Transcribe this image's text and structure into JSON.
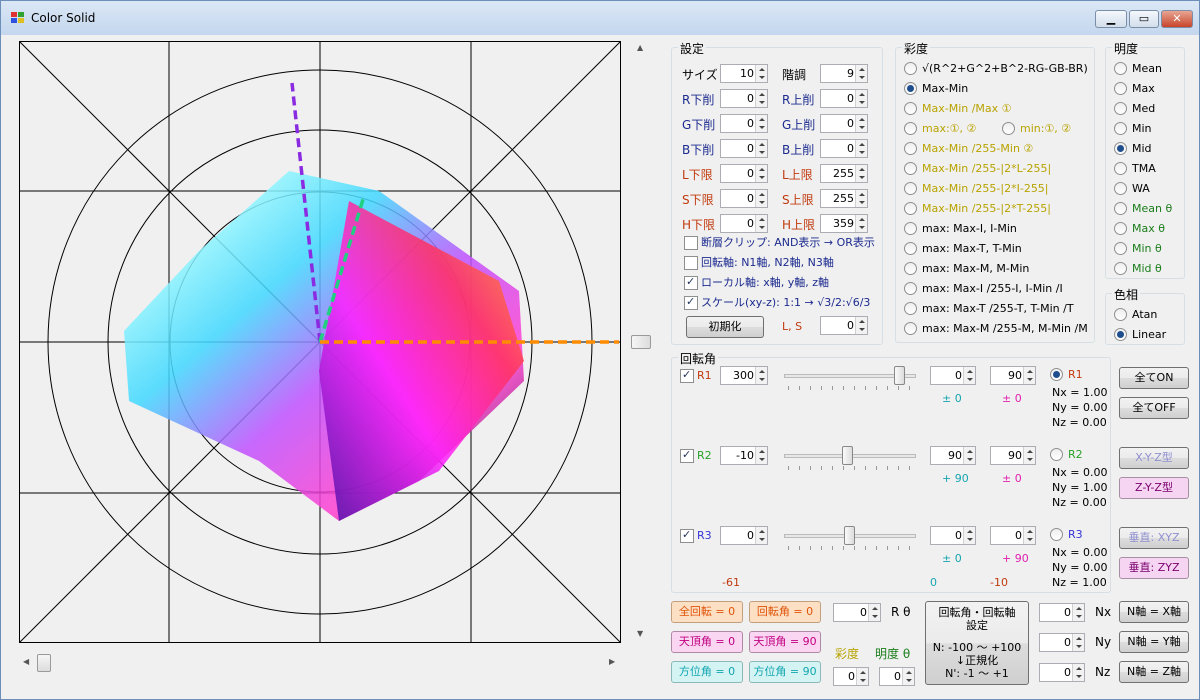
{
  "window": {
    "title": "Color Solid",
    "minimize": "▁",
    "maximize": "▭",
    "close": "✕"
  },
  "settings": {
    "title": "設定",
    "fields": [
      {
        "label": "サイズ",
        "value": "10"
      },
      {
        "label": "階調",
        "value": "9"
      },
      {
        "label": "R下削",
        "value": "0"
      },
      {
        "label": "R上削",
        "value": "0"
      },
      {
        "label": "G下削",
        "value": "0"
      },
      {
        "label": "G上削",
        "value": "0"
      },
      {
        "label": "B下削",
        "value": "0"
      },
      {
        "label": "B上削",
        "value": "0"
      },
      {
        "label": "L下限",
        "value": "0"
      },
      {
        "label": "L上限",
        "value": "255"
      },
      {
        "label": "S下限",
        "value": "0"
      },
      {
        "label": "S上限",
        "value": "255"
      },
      {
        "label": "H下限",
        "value": "0"
      },
      {
        "label": "H上限",
        "value": "359"
      }
    ],
    "checks": [
      {
        "label": "断層クリップ: AND表示 → OR表示",
        "checked": false
      },
      {
        "label": "回転軸: N1軸, N2軸, N3軸",
        "checked": false
      },
      {
        "label": "ローカル軸: x軸, y軸, z軸",
        "checked": true
      },
      {
        "label": "スケール(xy-z): 1:1 → √3/2:√6/3",
        "checked": true
      }
    ],
    "reset_button": "初期化",
    "ls_label": "L, S",
    "ls_value": "0"
  },
  "saturation": {
    "title": "彩度",
    "options": [
      "√(R^2+G^2+B^2-RG-GB-BR)",
      "Max-Min",
      "Max-Min /Max ①",
      "max:①, ②",
      "min:①, ②",
      "Max-Min /255-Min ②",
      "Max-Min /255-|2*L-255|",
      "Max-Min /255-|2*I-255|",
      "Max-Min /255-|2*T-255|",
      "max: Max-I, I-Min",
      "max: Max-T, T-Min",
      "max: Max-M, M-Min",
      "max: Max-I /255-I, I-Min /I",
      "max: Max-T /255-T, T-Min /T",
      "max: Max-M /255-M, M-Min /M"
    ],
    "selected": 1
  },
  "lightness": {
    "title": "明度",
    "options": [
      "Mean",
      "Max",
      "Med",
      "Min",
      "Mid",
      "TMA",
      "WA",
      "Mean θ",
      "Max θ",
      "Min θ",
      "Mid θ"
    ],
    "selected": 4
  },
  "hue": {
    "title": "色相",
    "options": [
      "Atan",
      "Linear"
    ],
    "selected": 1
  },
  "rotation": {
    "title": "回転角",
    "rows": [
      {
        "name": "R1",
        "checked": true,
        "value": "300",
        "slider_fraction": 0.92,
        "a": "0",
        "b": "90",
        "sub_a": "± 0",
        "sub_b": "± 0",
        "nx": "Nx = 1.00",
        "ny": "Ny = 0.00",
        "nz": "Nz = 0.00",
        "selected": true
      },
      {
        "name": "R2",
        "checked": true,
        "value": "-10",
        "slider_fraction": 0.48,
        "a": "90",
        "b": "90",
        "sub_a": "+ 90",
        "sub_b": "± 0",
        "nx": "Nx = 0.00",
        "ny": "Ny = 1.00",
        "nz": "Nz = 0.00",
        "selected": false
      },
      {
        "name": "R3",
        "checked": true,
        "value": "0",
        "slider_fraction": 0.5,
        "a": "0",
        "b": "0",
        "sub_a": "± 0",
        "sub_b": "+ 90",
        "nx": "Nx = 0.00",
        "ny": "Ny = 0.00",
        "nz": "Nz = 1.00",
        "selected": false
      }
    ],
    "footer": [
      "-61",
      "0",
      "-10"
    ],
    "buttons": [
      "全てON",
      "全てOFF",
      "X-Y-Z型",
      "Z-Y-Z型",
      "垂直: XYZ",
      "垂直: ZYZ"
    ]
  },
  "bottom": {
    "left_buttons": [
      "全回転 = 0",
      "回転角 = 0",
      "天頂角 = 0",
      "天頂角 = 90",
      "方位角 = 0",
      "方位角 = 90"
    ],
    "r_theta_value": "0",
    "r_theta_label": "R θ",
    "sat_label": "彩度",
    "light_label": "明度 θ",
    "sat_value": "0",
    "light_value": "0",
    "axis_box": {
      "title1": "回転角・回転軸",
      "title2": "設定",
      "line1": "N: -100 〜 +100",
      "line2": "↓正規化",
      "line3": "N': -1 〜 +1"
    },
    "n_rows": [
      {
        "value": "0",
        "label": "Nx",
        "button": "N軸 = X軸"
      },
      {
        "value": "0",
        "label": "Ny",
        "button": "N軸 = Y軸"
      },
      {
        "value": "0",
        "label": "Nz",
        "button": "N軸 = Z軸"
      }
    ]
  },
  "colors": {
    "accent": "#1f4e8c",
    "axis_z": "#8a2be2",
    "axis_y": "#20c060",
    "axis_x": "#ff8c00"
  }
}
